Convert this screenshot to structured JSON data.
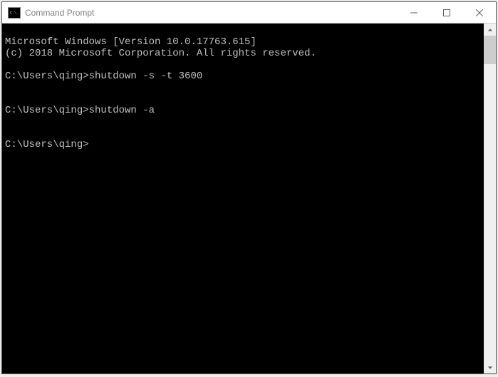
{
  "window": {
    "title": "Command Prompt"
  },
  "console": {
    "banner_line1": "Microsoft Windows [Version 10.0.17763.615]",
    "banner_line2": "(c) 2018 Microsoft Corporation. All rights reserved.",
    "entries": [
      {
        "prompt": "C:\\Users\\qing>",
        "command": "shutdown -s -t 3600"
      },
      {
        "prompt": "C:\\Users\\qing>",
        "command": "shutdown -a"
      }
    ],
    "current_prompt": "C:\\Users\\qing>"
  }
}
